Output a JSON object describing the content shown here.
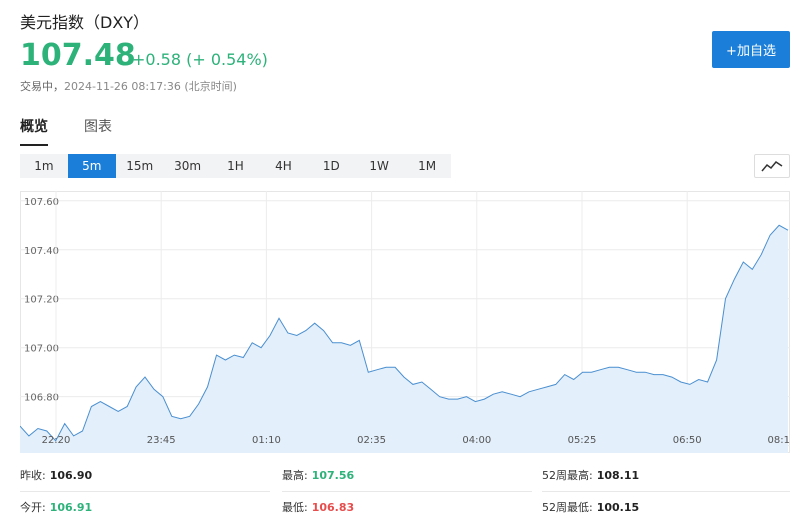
{
  "header": {
    "title": "美元指数（DXY）",
    "price": "107.48",
    "change": "+0.58 (+ 0.54%)",
    "status_label": "交易中，",
    "timestamp": "2024-11-26 08:17:36 (北京时间)",
    "add_watchlist_label": "+加自选"
  },
  "tabs": [
    {
      "label": "概览",
      "active": true
    },
    {
      "label": "图表",
      "active": false
    }
  ],
  "timeframes": [
    {
      "label": "1m",
      "active": false
    },
    {
      "label": "5m",
      "active": true
    },
    {
      "label": "15m",
      "active": false
    },
    {
      "label": "30m",
      "active": false
    },
    {
      "label": "1H",
      "active": false
    },
    {
      "label": "4H",
      "active": false
    },
    {
      "label": "1D",
      "active": false
    },
    {
      "label": "1W",
      "active": false
    },
    {
      "label": "1M",
      "active": false
    }
  ],
  "chart_type_icon": "line-chart-icon",
  "colors": {
    "up": "#2db27a",
    "down": "#e84d4d",
    "accent": "#1b7fd9",
    "line": "#4a8fd0",
    "fill": "#e3effb"
  },
  "chart_data": {
    "type": "area",
    "y_ticks": [
      "107.60",
      "107.40",
      "107.20",
      "107.00",
      "106.80",
      "106.60"
    ],
    "x_ticks": [
      "22:20",
      "23:45",
      "01:10",
      "02:35",
      "04:00",
      "05:25",
      "06:50",
      "08:1"
    ],
    "ylim": [
      106.57,
      107.64
    ],
    "values": [
      106.68,
      106.64,
      106.67,
      106.66,
      106.62,
      106.69,
      106.64,
      106.66,
      106.76,
      106.78,
      106.76,
      106.74,
      106.76,
      106.84,
      106.88,
      106.83,
      106.8,
      106.72,
      106.71,
      106.72,
      106.77,
      106.84,
      106.97,
      106.95,
      106.97,
      106.96,
      107.02,
      107.0,
      107.05,
      107.12,
      107.06,
      107.05,
      107.07,
      107.1,
      107.07,
      107.02,
      107.02,
      107.01,
      107.03,
      106.9,
      106.91,
      106.92,
      106.92,
      106.88,
      106.85,
      106.86,
      106.83,
      106.8,
      106.79,
      106.79,
      106.8,
      106.78,
      106.79,
      106.81,
      106.82,
      106.81,
      106.8,
      106.82,
      106.83,
      106.84,
      106.85,
      106.89,
      106.87,
      106.9,
      106.9,
      106.91,
      106.92,
      106.92,
      106.91,
      106.9,
      106.9,
      106.89,
      106.89,
      106.88,
      106.86,
      106.85,
      106.87,
      106.86,
      106.95,
      107.2,
      107.28,
      107.35,
      107.32,
      107.38,
      107.46,
      107.5,
      107.48
    ]
  },
  "stats": [
    [
      {
        "label": "昨收:",
        "value": "106.90",
        "tone": "dark"
      },
      {
        "label": "最高:",
        "value": "107.56",
        "tone": "green"
      },
      {
        "label": "52周最高:",
        "value": "108.11",
        "tone": "dark"
      }
    ],
    [
      {
        "label": "今开:",
        "value": "106.91",
        "tone": "green"
      },
      {
        "label": "最低:",
        "value": "106.83",
        "tone": "red"
      },
      {
        "label": "52周最低:",
        "value": "100.15",
        "tone": "dark"
      }
    ]
  ]
}
